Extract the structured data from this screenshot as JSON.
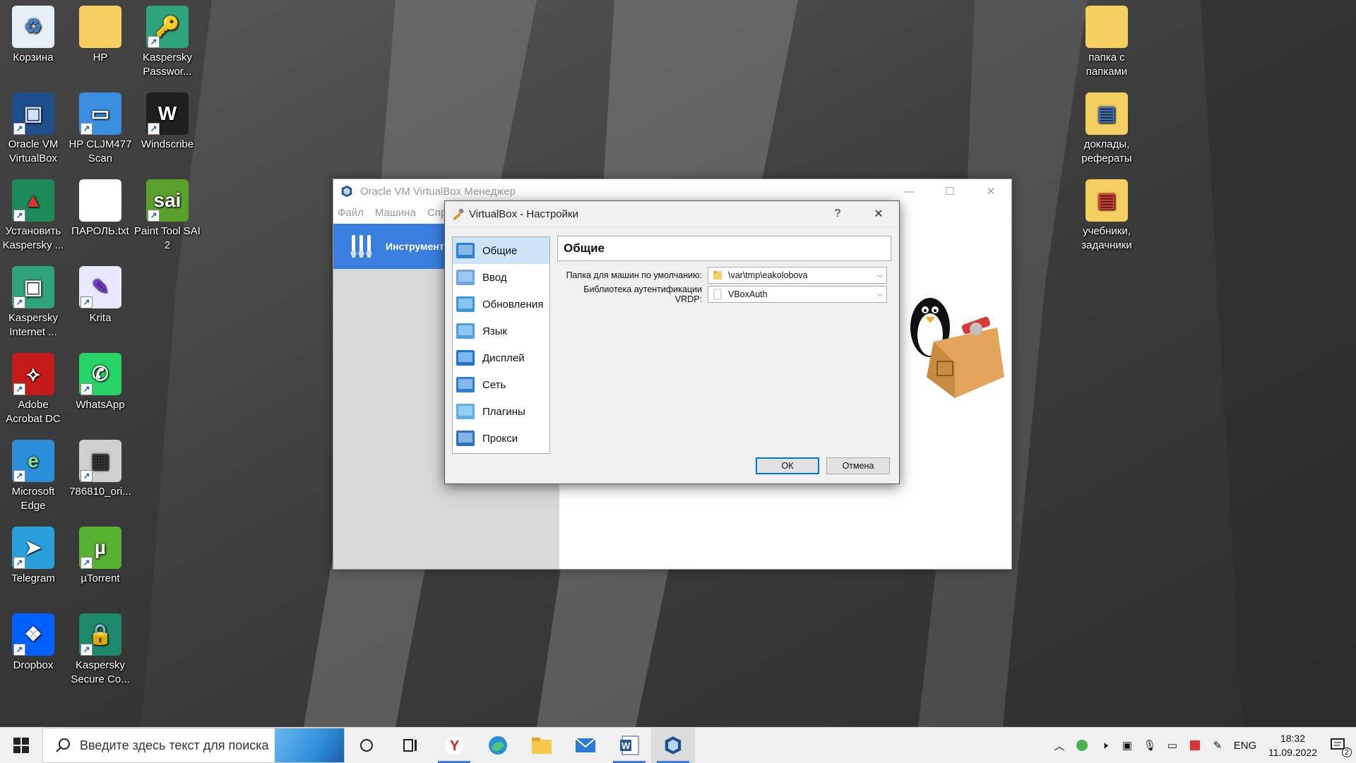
{
  "desktop": {
    "icons": [
      {
        "label": "Корзина",
        "icon": "recycle-bin-icon"
      },
      {
        "label": "HP",
        "icon": "folder-icon"
      },
      {
        "label": "Kaspersky\nPasswor...",
        "icon": "kaspersky-password-icon"
      },
      {
        "label": "Oracle VM\nVirtualBox",
        "icon": "virtualbox-icon"
      },
      {
        "label": "HP CLJM477\nScan",
        "icon": "scanner-icon"
      },
      {
        "label": "Windscribe",
        "icon": "windscribe-icon"
      },
      {
        "label": "Установить\nKaspersky ...",
        "icon": "kaspersky-install-icon"
      },
      {
        "label": "ПАРОЛЬ.txt",
        "icon": "text-file-icon"
      },
      {
        "label": "Paint Tool SAI\n2",
        "icon": "sai-icon"
      },
      {
        "label": "Kaspersky\nInternet ...",
        "icon": "kaspersky-internet-icon"
      },
      {
        "label": "Krita",
        "icon": "krita-icon"
      },
      {
        "label": "Adobe\nAcrobat DC",
        "icon": "acrobat-icon"
      },
      {
        "label": "WhatsApp",
        "icon": "whatsapp-icon"
      },
      {
        "label": "Microsoft\nEdge",
        "icon": "edge-icon"
      },
      {
        "label": "786810_ori...",
        "icon": "image-file-icon"
      },
      {
        "label": "Telegram",
        "icon": "telegram-icon"
      },
      {
        "label": "µTorrent",
        "icon": "utorrent-icon"
      },
      {
        "label": "Dropbox",
        "icon": "dropbox-icon"
      },
      {
        "label": "Kaspersky\nSecure Co...",
        "icon": "kaspersky-vpn-icon"
      },
      {
        "label": "папка с\nпапками",
        "icon": "folder-icon"
      },
      {
        "label": "доклады,\nрефераты",
        "icon": "folder-docs-icon"
      },
      {
        "label": "учебники,\nзадачники",
        "icon": "folder-pdf-icon"
      }
    ]
  },
  "vbox_main": {
    "title": "Oracle VM VirtualBox Менеджер",
    "menu": [
      "Файл",
      "Машина",
      "Спр"
    ],
    "tools_label": "Инструменты"
  },
  "dialog": {
    "title": "VirtualBox - Настройки",
    "help": "?",
    "close": "✕",
    "nav": [
      {
        "label": "Общие",
        "icon": "general-icon",
        "selected": true
      },
      {
        "label": "Ввод",
        "icon": "input-icon"
      },
      {
        "label": "Обновления",
        "icon": "update-icon"
      },
      {
        "label": "Язык",
        "icon": "language-icon"
      },
      {
        "label": "Дисплей",
        "icon": "display-icon"
      },
      {
        "label": "Сеть",
        "icon": "network-icon"
      },
      {
        "label": "Плагины",
        "icon": "plugins-icon"
      },
      {
        "label": "Прокси",
        "icon": "proxy-icon"
      }
    ],
    "heading": "Общие",
    "folder_label": "Папка для машин по умолчанию:",
    "folder_value": "\\var\\tmp\\eakolobova",
    "vrdp_label": "Библиотека аутентификации VRDP:",
    "vrdp_value": "VBoxAuth",
    "ok": "ОК",
    "cancel": "Отмена"
  },
  "taskbar": {
    "search_placeholder": "Введите здесь текст для поиска",
    "lang": "ENG",
    "time": "18:32",
    "date": "11.09.2022",
    "notifications": "2"
  },
  "colors": {
    "accent": "#3a7ee0",
    "selection": "#cce4f7"
  }
}
